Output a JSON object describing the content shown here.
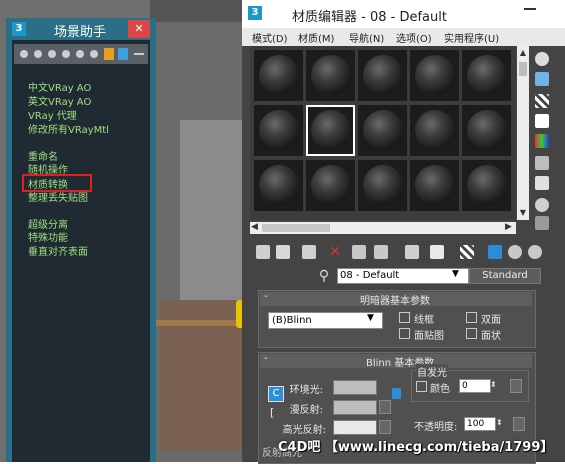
{
  "assistant": {
    "title": "场景助手",
    "close": "✕",
    "links": [
      "中文VRay AO",
      "英文VRay AO",
      "VRay 代理",
      "修改所有VRayMtl",
      "重命名",
      "随机操作",
      "材质转换",
      "整理丢失贴图",
      "超级分离",
      "特殊功能",
      "垂直对齐表面"
    ],
    "highlighted": "材质转换"
  },
  "material_editor": {
    "title": "材质编辑器 - 08 - Default",
    "menu": [
      "模式(D)",
      "材质(M)",
      "导航(N)",
      "选项(O)",
      "实用程序(U)"
    ],
    "material_name": "08 - Default",
    "material_type": "Standard",
    "shader_rollout": {
      "title": "明暗器基本参数",
      "shader": "(B)Blinn",
      "options": [
        "线框",
        "双面",
        "面贴图",
        "面状"
      ]
    },
    "blinn_rollout": {
      "title": "Blinn 基本参数",
      "ambient_label": "环境光:",
      "diffuse_label": "漫反射:",
      "specular_label": "高光反射:",
      "self_illum_label": "自发光",
      "color_label": "颜色",
      "color_value": "0",
      "opacity_label": "不透明度:",
      "opacity_value": "100",
      "lock_icon": "C"
    },
    "bottom_label": "反射高光"
  },
  "watermark": "C4D吧 【www.linecg.com/tieba/1799】",
  "colors": {
    "assistant_frame": "#2b6f86",
    "assistant_bg": "#1f2a33",
    "link_text": "#9fe07f",
    "highlight": "#e02020",
    "editor_bg": "#444444"
  }
}
